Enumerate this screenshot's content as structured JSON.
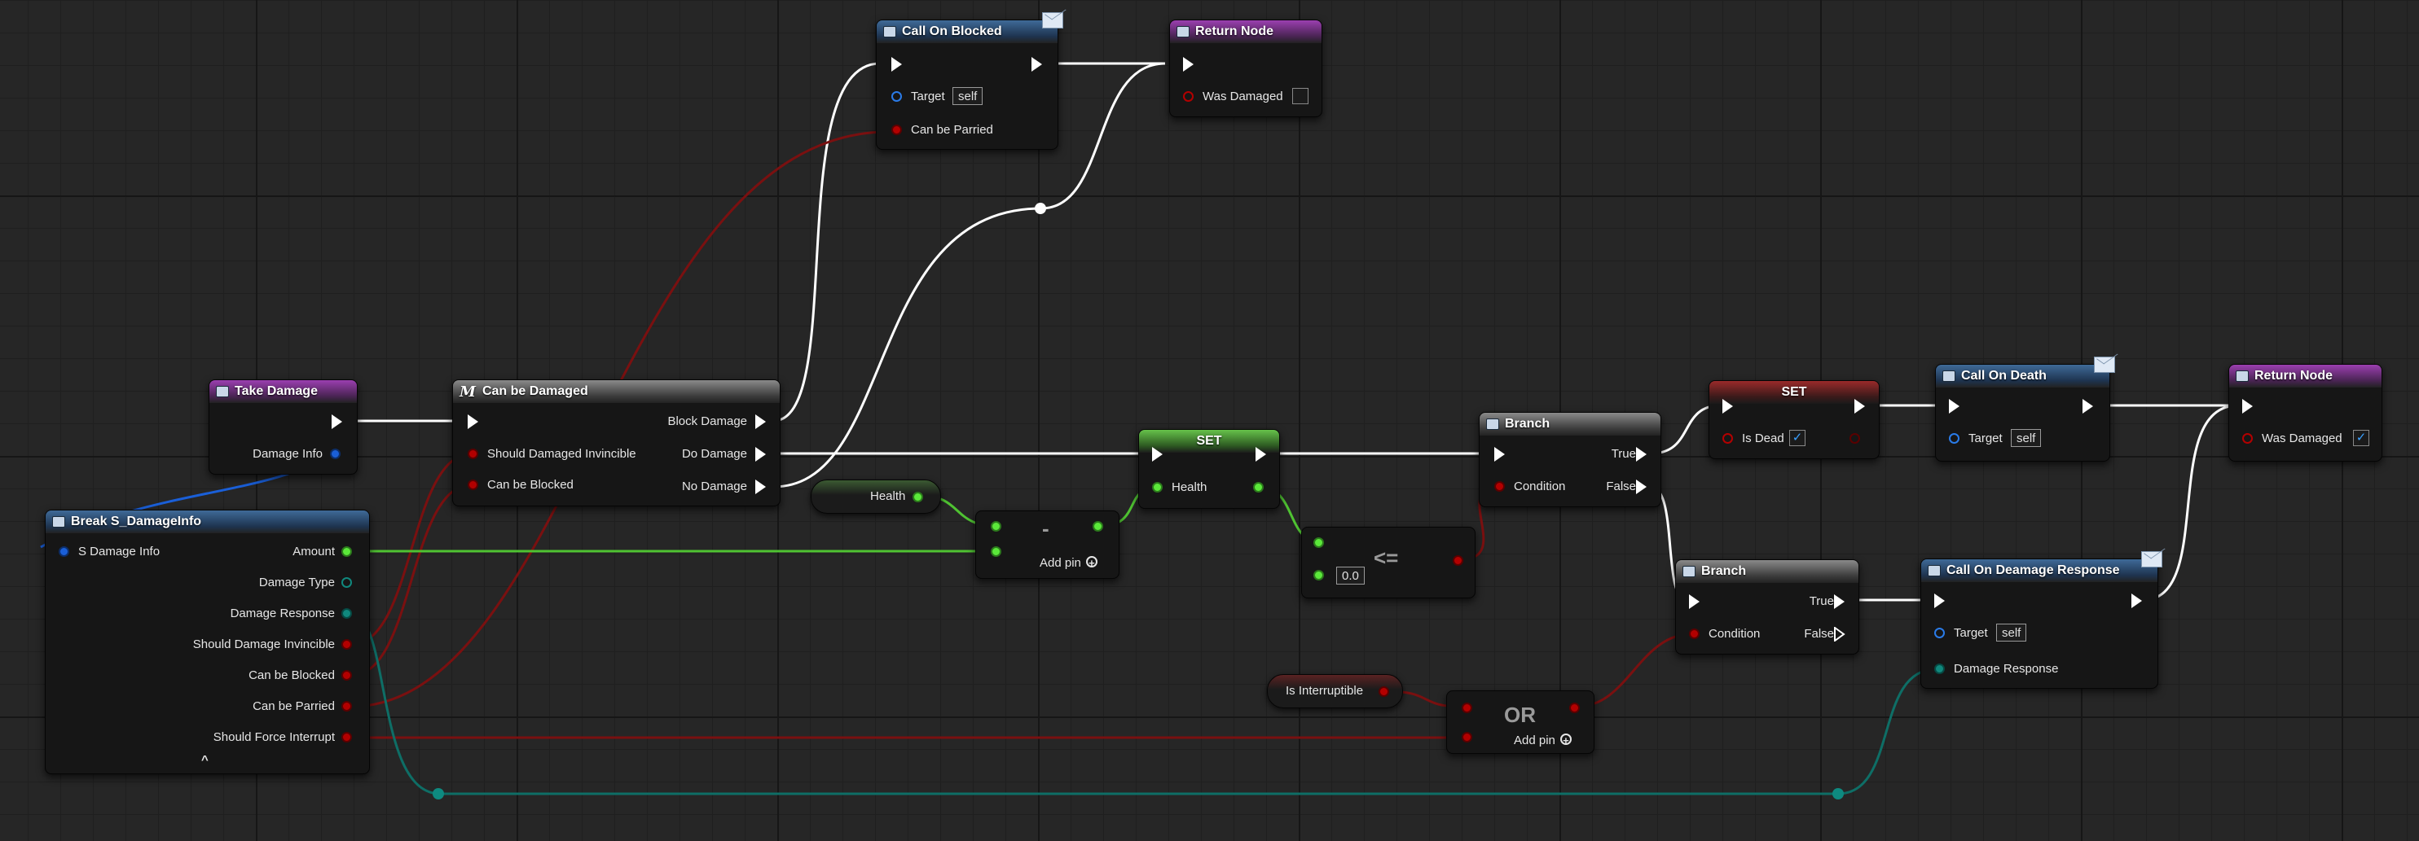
{
  "colors": {
    "exec_wire": "#ffffff",
    "bool_wire": "#8c0f0f",
    "float_wire": "#5ad43a",
    "struct_wire": "#1a6ae0",
    "enum_wire": "#0e7a70"
  },
  "nodes": {
    "call_on_blocked": {
      "title": "Call On Blocked",
      "target_label": "Target",
      "target_value": "self",
      "param": "Can be Parried"
    },
    "return_top": {
      "title": "Return Node",
      "param": "Was Damaged",
      "checked": ""
    },
    "take_damage": {
      "title": "Take Damage",
      "param": "Damage Info"
    },
    "can_be_damaged": {
      "title": "Can be Damaged",
      "macro_letter": "M",
      "inputs": [
        "Should Damaged Invincible",
        "Can be Blocked"
      ],
      "outputs": [
        "Block Damage",
        "Do Damage",
        "No Damage"
      ]
    },
    "break_struct": {
      "title": "Break S_DamageInfo",
      "input": "S Damage Info",
      "outputs": [
        "Amount",
        "Damage Type",
        "Damage Response",
        "Should Damage Invincible",
        "Can be Blocked",
        "Can be Parried",
        "Should Force Interrupt"
      ],
      "collapse_icon": "^"
    },
    "get_health": {
      "label": "Health"
    },
    "subtract": {
      "op": "-",
      "add_pin": "Add pin"
    },
    "set_health": {
      "title": "SET",
      "label": "Health"
    },
    "less_equal": {
      "op": "<=",
      "value": "0.0"
    },
    "branch1": {
      "title": "Branch",
      "condition": "Condition",
      "true": "True",
      "false": "False"
    },
    "set_dead": {
      "title": "SET",
      "label": "Is Dead",
      "check": "✓"
    },
    "call_on_death": {
      "title": "Call On Death",
      "target_label": "Target",
      "target_value": "self"
    },
    "return_right": {
      "title": "Return Node",
      "param": "Was Damaged",
      "check": "✓"
    },
    "branch2": {
      "title": "Branch",
      "condition": "Condition",
      "true": "True",
      "false": "False"
    },
    "call_on_response": {
      "title": "Call On Deamage Response",
      "target_label": "Target",
      "target_value": "self",
      "param": "Damage Response"
    },
    "get_interruptible": {
      "label": "Is Interruptible"
    },
    "or_node": {
      "op": "OR",
      "add_pin": "Add pin"
    }
  }
}
